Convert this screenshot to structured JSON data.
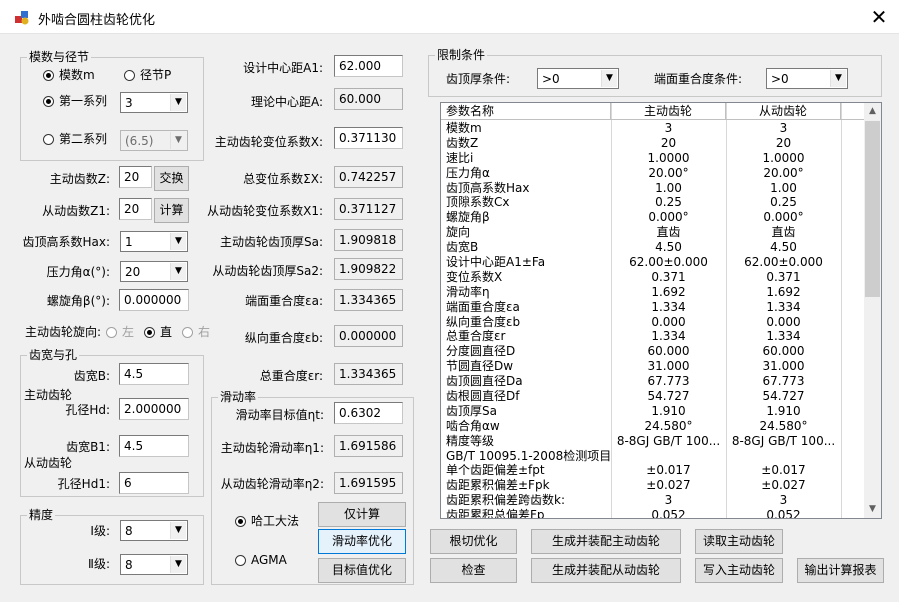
{
  "window": {
    "title": "外啮合圆柱齿轮优化",
    "close": "✕"
  },
  "module_group": {
    "title": "模数与径节",
    "radio_module": "模数m",
    "radio_pitch": "径节P",
    "radio_series1": "第一系列",
    "series1_value": "3",
    "radio_series2": "第二系列",
    "series2_value": "(6.5)"
  },
  "left_fields": {
    "z_label": "主动齿数Z:",
    "z_value": "20",
    "swap_button": "交换",
    "z1_label": "从动齿数Z1:",
    "z1_value": "20",
    "calc_button": "计算",
    "hax_label": "齿顶高系数Hax:",
    "hax_value": "1",
    "alpha_label": "压力角α(°):",
    "alpha_value": "20",
    "beta_label": "螺旋角β(°):",
    "beta_value": "0.000000",
    "dir_label": "主动齿轮旋向:",
    "dir_left": "左",
    "dir_straight": "直",
    "dir_right": "右"
  },
  "width_group": {
    "title": "齿宽与孔",
    "b_label": "齿宽B:",
    "b_value": "4.5",
    "drive_label": "主动齿轮",
    "hd_label": "孔径Hd:",
    "hd_value": "2.000000",
    "b1_label": "齿宽B1:",
    "b1_value": "4.5",
    "driven_label": "从动齿轮",
    "hd1_label": "孔径Hd1:",
    "hd1_value": "6"
  },
  "precision_group": {
    "title": "精度",
    "l1_label": "Ⅰ级:",
    "l1_value": "8",
    "l2_label": "Ⅱ级:",
    "l2_value": "8"
  },
  "middle": {
    "a1_label": "设计中心距A1:",
    "a1_value": "62.000",
    "a_label": "理论中心距A:",
    "a_value": "60.000",
    "x_label": "主动齿轮变位系数X:",
    "x_value": "0.371130",
    "sx_label": "总变位系数ΣX:",
    "sx_value": "0.742257",
    "x1_label": "从动齿轮变位系数X1:",
    "x1_value": "0.371127",
    "sa_label": "主动齿轮齿顶厚Sa:",
    "sa_value": "1.909818",
    "sa2_label": "从动齿轮齿顶厚Sa2:",
    "sa2_value": "1.909822",
    "ea_label": "端面重合度εa:",
    "ea_value": "1.334365",
    "eb_label": "纵向重合度εb:",
    "eb_value": "0.000000",
    "er_label": "总重合度εr:",
    "er_value": "1.334365"
  },
  "slip_group": {
    "title": "滑动率",
    "target_label": "滑动率目标值ηt:",
    "target_value": "0.6302",
    "n1_label": "主动齿轮滑动率η1:",
    "n1_value": "1.691586",
    "n2_label": "从动齿轮滑动率η2:",
    "n2_value": "1.691595",
    "radio_hit": "哈工大法",
    "radio_agma": "AGMA",
    "btn_calc": "仅计算",
    "btn_slip_opt": "滑动率优化",
    "btn_target_opt": "目标值优化"
  },
  "limits_group": {
    "title": "限制条件",
    "top_label": "齿顶厚条件:",
    "top_value": ">0",
    "overlap_label": "端面重合度条件:",
    "overlap_value": ">0"
  },
  "table": {
    "headers": [
      "参数名称",
      "主动齿轮",
      "从动齿轮"
    ],
    "rows": [
      [
        "模数m",
        "3",
        "3"
      ],
      [
        "齿数Z",
        "20",
        "20"
      ],
      [
        "速比i",
        "1.0000",
        "1.0000"
      ],
      [
        "压力角α",
        "20.00°",
        "20.00°"
      ],
      [
        "齿顶高系数Hax",
        "1.00",
        "1.00"
      ],
      [
        "顶隙系数Cx",
        "0.25",
        "0.25"
      ],
      [
        "螺旋角β",
        "0.000°",
        "0.000°"
      ],
      [
        "旋向",
        "直齿",
        "直齿"
      ],
      [
        "齿宽B",
        "4.50",
        "4.50"
      ],
      [
        "设计中心距A1±Fa",
        "62.00±0.000",
        "62.00±0.000"
      ],
      [
        "变位系数X",
        "0.371",
        "0.371"
      ],
      [
        "滑动率η",
        "1.692",
        "1.692"
      ],
      [
        "端面重合度εa",
        "1.334",
        "1.334"
      ],
      [
        "纵向重合度εb",
        "0.000",
        "0.000"
      ],
      [
        "总重合度εr",
        "1.334",
        "1.334"
      ],
      [
        "分度圆直径D",
        "60.000",
        "60.000"
      ],
      [
        "节圆直径Dw",
        "31.000",
        "31.000"
      ],
      [
        "齿顶圆直径Da",
        "67.773",
        "67.773"
      ],
      [
        "齿根圆直径Df",
        "54.727",
        "54.727"
      ],
      [
        "齿顶厚Sa",
        "1.910",
        "1.910"
      ],
      [
        "啮合角αw",
        "24.580°",
        "24.580°"
      ],
      [
        "精度等级",
        "8-8GJ GB/T 100...",
        "8-8GJ GB/T 100..."
      ],
      [
        "GB/T 10095.1-2008检测项目",
        "",
        ""
      ],
      [
        "单个齿距偏差±fpt",
        "±0.017",
        "±0.017"
      ],
      [
        "齿距累积偏差±Fpk",
        "±0.027",
        "±0.027"
      ],
      [
        "齿距累积偏差跨齿数k:",
        "3",
        "3"
      ],
      [
        "齿距累积总偏差Fp",
        "0.052",
        "0.052"
      ]
    ]
  },
  "bottom_buttons": {
    "root_opt": "根切优化",
    "check": "检查",
    "gen_drive": "生成并装配主动齿轮",
    "gen_driven": "生成并装配从动齿轮",
    "read_drive": "读取主动齿轮",
    "write_drive": "写入主动齿轮",
    "export": "输出计算报表"
  }
}
